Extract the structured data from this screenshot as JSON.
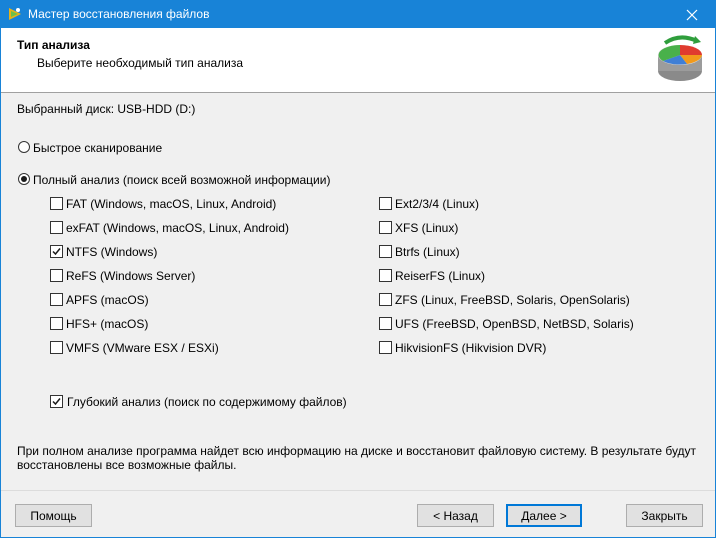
{
  "window": {
    "title": "Мастер восстановления файлов"
  },
  "header": {
    "title": "Тип анализа",
    "subtitle": "Выберите необходимый тип анализа"
  },
  "disk": {
    "label": "Выбранный диск: USB-HDD (D:)"
  },
  "scan": {
    "quick_label": "Быстрое сканирование",
    "quick_selected": false,
    "full_label": "Полный анализ (поиск всей возможной информации)",
    "full_selected": true
  },
  "filesystems_left": [
    {
      "label": "FAT (Windows, macOS, Linux, Android)",
      "checked": false
    },
    {
      "label": "exFAT (Windows, macOS, Linux, Android)",
      "checked": false
    },
    {
      "label": "NTFS (Windows)",
      "checked": true
    },
    {
      "label": "ReFS (Windows Server)",
      "checked": false
    },
    {
      "label": "APFS (macOS)",
      "checked": false
    },
    {
      "label": "HFS+ (macOS)",
      "checked": false
    },
    {
      "label": "VMFS (VMware ESX / ESXi)",
      "checked": false
    }
  ],
  "filesystems_right": [
    {
      "label": "Ext2/3/4 (Linux)",
      "checked": false
    },
    {
      "label": "XFS (Linux)",
      "checked": false
    },
    {
      "label": "Btrfs (Linux)",
      "checked": false
    },
    {
      "label": "ReiserFS (Linux)",
      "checked": false
    },
    {
      "label": "ZFS (Linux, FreeBSD, Solaris, OpenSolaris)",
      "checked": false
    },
    {
      "label": "UFS (FreeBSD, OpenBSD, NetBSD, Solaris)",
      "checked": false
    },
    {
      "label": "HikvisionFS (Hikvision DVR)",
      "checked": false
    }
  ],
  "deep": {
    "label": "Глубокий анализ (поиск по содержимому файлов)",
    "checked": true
  },
  "info": {
    "line1": "При полном анализе программа найдет всю информацию на диске и восстановит файловую систему. В результате будут",
    "line2": "восстановлены все возможные файлы."
  },
  "buttons": {
    "help": "Помощь",
    "back": "< Назад",
    "next": "Далее >",
    "close": "Закрыть"
  },
  "colors": {
    "titlebar": "#1883d7",
    "default_button_border": "#0078d7"
  },
  "icons": {
    "app": "wizard-app-icon",
    "close": "close-icon",
    "logo": "disk-recovery-logo"
  }
}
